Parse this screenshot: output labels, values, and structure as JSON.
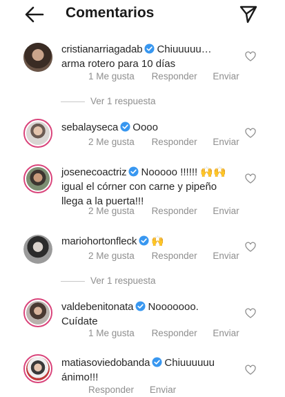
{
  "header": {
    "title": "Comentarios"
  },
  "actions": {
    "like": "Me gusta",
    "reply": "Responder",
    "send": "Enviar"
  },
  "comments": [
    {
      "user": "cristianarriagadab",
      "text": "Chiuuuuu… arma rotero para 10 días",
      "likes": "1 Me gusta",
      "reply": "Responder",
      "send": "Enviar",
      "view_replies": "Ver 1 respuesta"
    },
    {
      "user": "sebalayseca",
      "text": "Oooo",
      "likes": "2 Me gusta",
      "reply": "Responder",
      "send": "Enviar"
    },
    {
      "user": "josenecoactriz",
      "text": "Nooooo !!!!!! 🙌🙌 igual el córner con carne y pipeño llega a la puerta!!!",
      "likes": "2 Me gusta",
      "reply": "Responder",
      "send": "Enviar"
    },
    {
      "user": "mariohortonfleck",
      "text": "🙌",
      "likes": "2 Me gusta",
      "reply": "Responder",
      "send": "Enviar",
      "view_replies": "Ver 1 respuesta"
    },
    {
      "user": "valdebenitonata",
      "text": "Nooooooo. Cuídate",
      "likes": "1 Me gusta",
      "reply": "Responder",
      "send": "Enviar"
    },
    {
      "user": "matiasoviedobanda",
      "text": "Chiuuuuuu ánimo!!!",
      "reply": "Responder",
      "send": "Enviar"
    }
  ],
  "colors": {
    "verified": "#3897f0",
    "meta": "#8e8e8e",
    "ring": "#d9437a"
  }
}
